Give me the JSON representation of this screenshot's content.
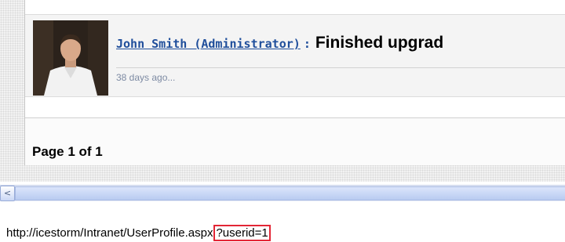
{
  "feed": {
    "item": {
      "author": "John Smith (Administrator)",
      "separator": ":",
      "status": "Finished upgrad",
      "timestamp": "38 days ago..."
    }
  },
  "pager": {
    "label": "Page 1 of 1"
  },
  "scrollbar": {
    "left_arrow": "<"
  },
  "statusbar": {
    "url_base": "http://icestorm/Intranet/UserProfile.aspx",
    "url_query": "?userid=1",
    "highlight_color": "#e32636"
  }
}
